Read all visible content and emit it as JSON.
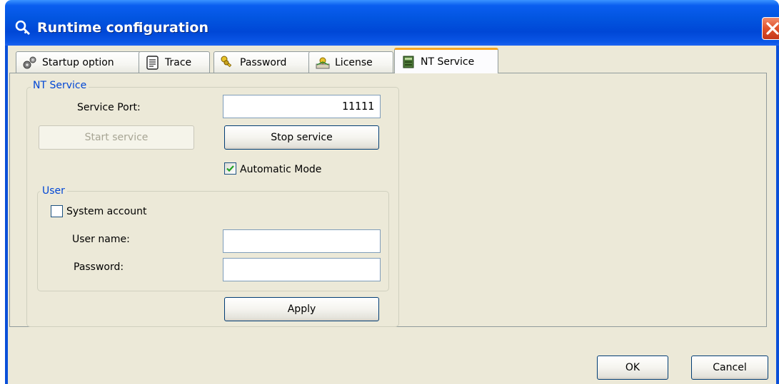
{
  "window": {
    "title": "Runtime configuration",
    "colors": {
      "titlebar": "#0047d6",
      "client_bg": "#ece9d8",
      "group_title": "#0046d5",
      "close_button": "#e0512a",
      "active_tab_highlight": "#f5a623"
    }
  },
  "tabs": [
    {
      "label": "Startup option",
      "icon": "gears-icon",
      "active": false
    },
    {
      "label": "Trace",
      "icon": "notepad-icon",
      "active": false
    },
    {
      "label": "Password",
      "icon": "keys-icon",
      "active": false
    },
    {
      "label": "License",
      "icon": "certificate-icon",
      "active": false
    },
    {
      "label": "NT Service",
      "icon": "server-icon",
      "active": true
    }
  ],
  "nt_service": {
    "group_title": "NT Service",
    "service_port_label": "Service Port:",
    "service_port_value": "11111",
    "start_service_label": "Start service",
    "stop_service_label": "Stop service",
    "automatic_mode_label": "Automatic Mode",
    "automatic_mode_checked": true,
    "apply_label": "Apply"
  },
  "user": {
    "group_title": "User",
    "system_account_label": "System account",
    "system_account_checked": false,
    "user_name_label": "User name:",
    "user_name_value": "",
    "password_label": "Password:",
    "password_value": ""
  },
  "footer": {
    "ok_label": "OK",
    "cancel_label": "Cancel"
  }
}
